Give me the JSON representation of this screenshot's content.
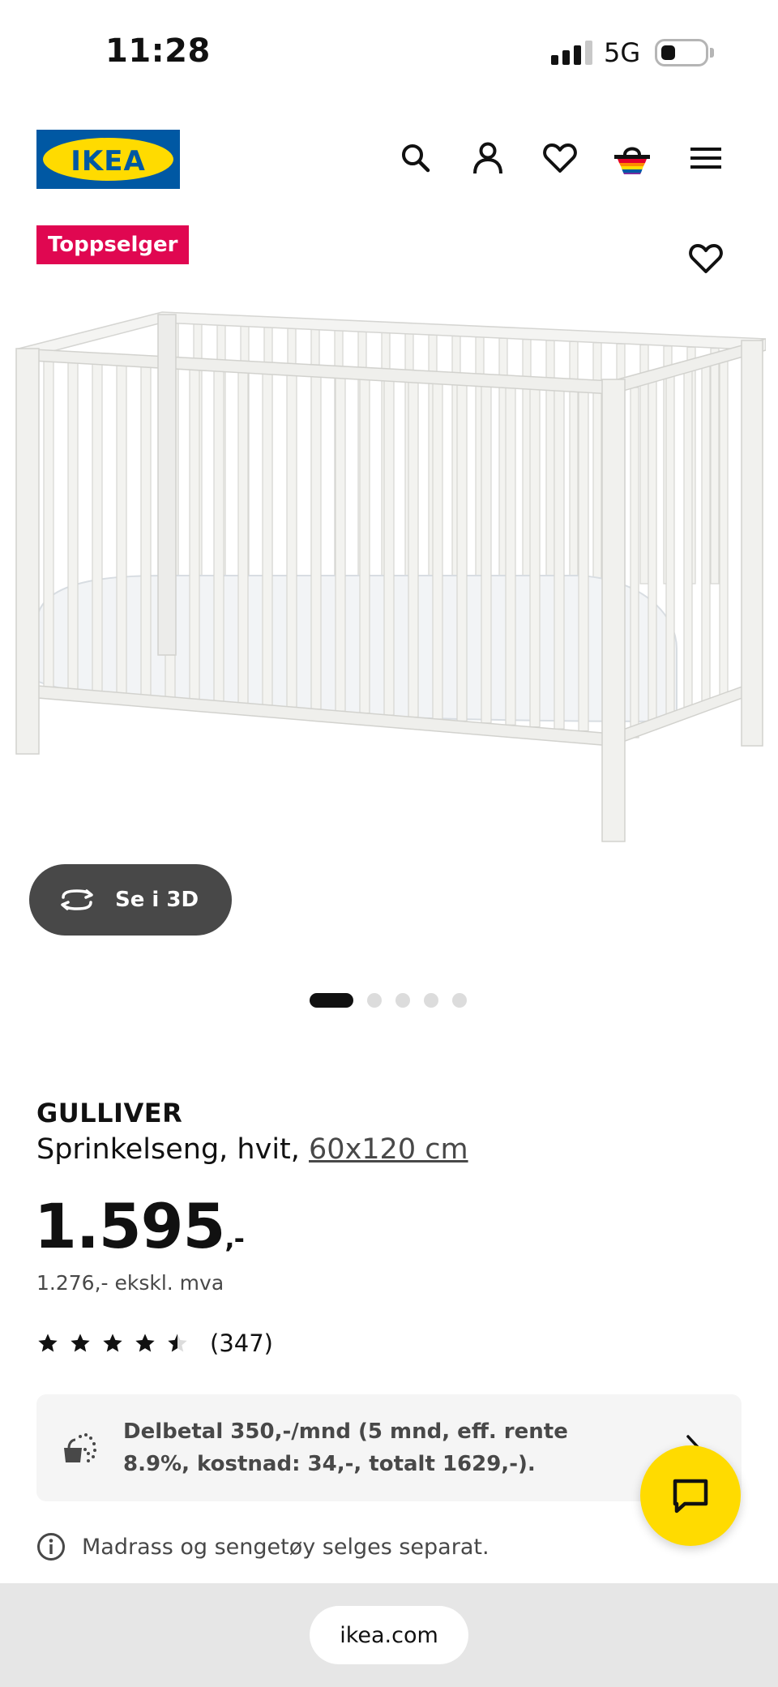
{
  "status_bar": {
    "time": "11:28",
    "network": "5G"
  },
  "header": {
    "logo_text": "IKEA",
    "icons": [
      "search-icon",
      "user-icon",
      "heart-icon",
      "basket-icon",
      "menu-icon"
    ]
  },
  "badge": {
    "label": "Toppselger",
    "color": "#e00751"
  },
  "media": {
    "view_3d_label": "Se i 3D",
    "image_count": 5,
    "active_index": 0
  },
  "product": {
    "name": "GULLIVER",
    "description": "Sprinkelseng, hvit, ",
    "size": "60x120 cm",
    "price": "1.595",
    "price_suffix": ",-",
    "price_ex_vat": "1.276,- ekskl. mva",
    "rating_value": 4.5,
    "rating_count": "(347)"
  },
  "payment": {
    "text": "Delbetal 350,-/mnd (5 mnd, eff. rente 8.9%, kostnad: 34,-, totalt 1629,-)."
  },
  "note": {
    "text": "Madrass og sengetøy selges separat."
  },
  "browser": {
    "url": "ikea.com"
  },
  "colors": {
    "brand_blue": "#0058a3",
    "brand_yellow": "#ffdb00",
    "badge_red": "#e00751"
  }
}
